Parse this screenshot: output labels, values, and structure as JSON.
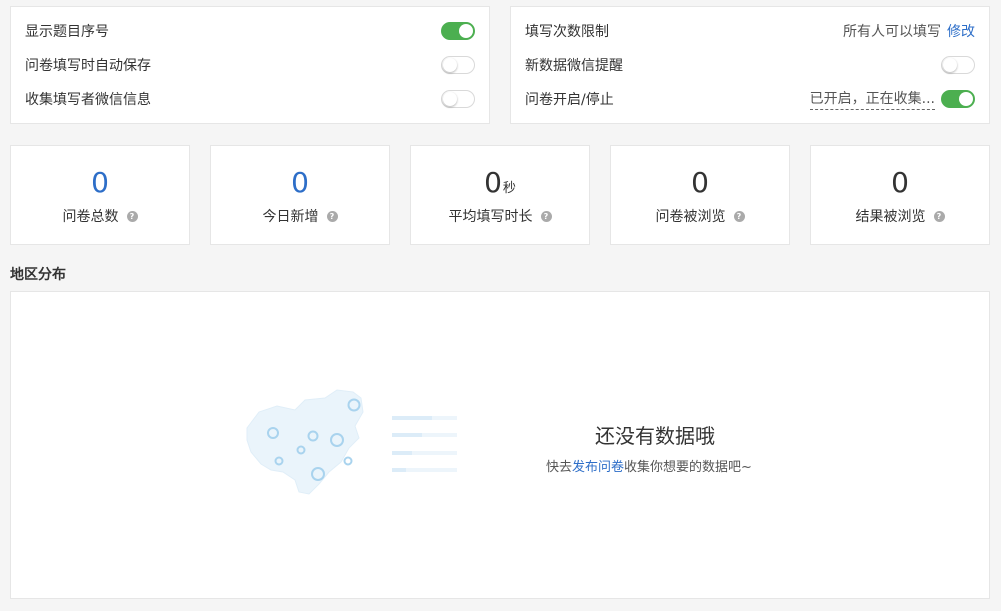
{
  "left_settings": {
    "rows": [
      {
        "label": "显示题目序号",
        "toggle": true
      },
      {
        "label": "问卷填写时自动保存",
        "toggle": false
      },
      {
        "label": "收集填写者微信信息",
        "toggle": false
      }
    ]
  },
  "right_settings": {
    "fill_limit": {
      "label": "填写次数限制",
      "value": "所有人可以填写",
      "action": "修改"
    },
    "wechat_reminder": {
      "label": "新数据微信提醒",
      "toggle": false
    },
    "survey_status": {
      "label": "问卷开启/停止",
      "status": "已开启，正在收集...",
      "toggle": true
    }
  },
  "stats": [
    {
      "value": "0",
      "unit": "",
      "label": "问卷总数",
      "accent": "#2d6ec8"
    },
    {
      "value": "0",
      "unit": "",
      "label": "今日新增",
      "accent": "#2d6ec8"
    },
    {
      "value": "0",
      "unit": "秒",
      "label": "平均填写时长",
      "accent": "#333333"
    },
    {
      "value": "0",
      "unit": "",
      "label": "问卷被浏览",
      "accent": "#333333"
    },
    {
      "value": "0",
      "unit": "",
      "label": "结果被浏览",
      "accent": "#333333"
    }
  ],
  "help_icon": "?",
  "region": {
    "title": "地区分布",
    "empty_title": "还没有数据哦",
    "empty_desc_prefix": "快去",
    "empty_desc_link": "发布问卷",
    "empty_desc_suffix": "收集你想要的数据吧~",
    "illustration_icon": "china-map-icon"
  },
  "colors": {
    "toggle_on": "#4caf50",
    "link": "#2d6ec8",
    "map_fill": "#eaf4fb",
    "map_circle": "#a9d3ee"
  }
}
